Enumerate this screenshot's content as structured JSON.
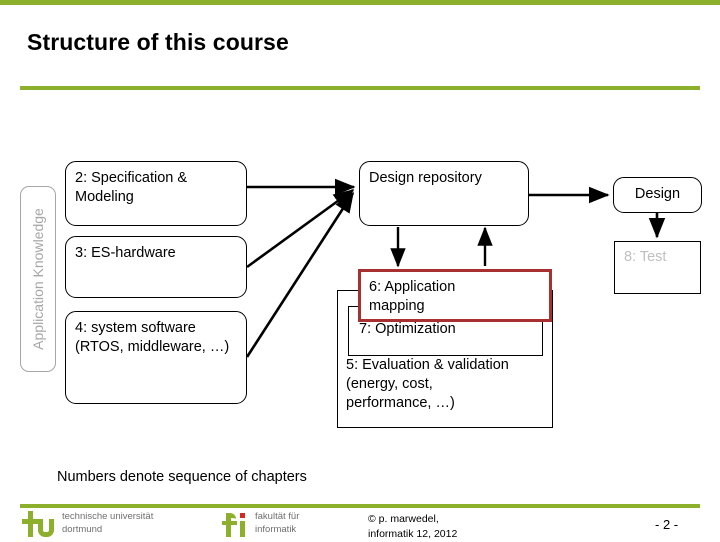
{
  "slide": {
    "title": "Structure of this course",
    "caption": "Numbers denote sequence of chapters",
    "accent_green": "#8cb02c",
    "accent_red": "#a93030",
    "muted_gray": "#bfbfbf"
  },
  "diagram": {
    "application_knowledge_label": "Application Knowledge",
    "left_boxes": [
      {
        "id": "spec",
        "text": "2: Specification &\nModeling"
      },
      {
        "id": "hw",
        "text": "3:\nES-hardware"
      },
      {
        "id": "sw",
        "text": "4: system\nsoftware (RTOS,\nmiddleware, …)"
      }
    ],
    "repository_box": "Design\nrepository",
    "mapping_box": "6: Application\nmapping",
    "optimization_box": "7: Optimization",
    "evaluation_box": "5: Evaluation & validation\n(energy, cost,\nperformance, …)",
    "design_box": "Design",
    "test_box": "8:\nTest"
  },
  "footer": {
    "tu_logo_line1": "technische universität",
    "tu_logo_line2": "dortmund",
    "fi_logo_line1": "fakultät für",
    "fi_logo_line2": "informatik",
    "copyright": "© p. marwedel,\ninformatik 12,  2012",
    "page_number": "- 2 -"
  }
}
